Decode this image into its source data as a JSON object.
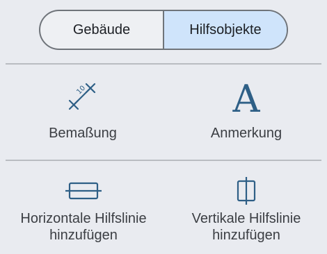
{
  "segmented_control": {
    "options": [
      "Gebäude",
      "Hilfsobjekte"
    ],
    "selected": "Hilfsobjekte"
  },
  "tools": {
    "dimension": {
      "label": "Bemaßung",
      "icon": "dimension-icon",
      "icon_text": "10"
    },
    "annotation": {
      "label": "Anmerkung",
      "icon": "text-A-icon",
      "icon_text": "A"
    },
    "horizontal_guide": {
      "label_line1": "Horizontale Hilfslinie",
      "label_line2": "hinzufügen",
      "icon": "horizontal-guide-icon"
    },
    "vertical_guide": {
      "label_line1": "Vertikale Hilfslinie",
      "label_line2": "hinzufügen",
      "icon": "vertical-guide-icon"
    }
  },
  "colors": {
    "background": "#e9ebf0",
    "accent_icon": "#2e5f86",
    "selected_segment": "#cfe4fb"
  }
}
